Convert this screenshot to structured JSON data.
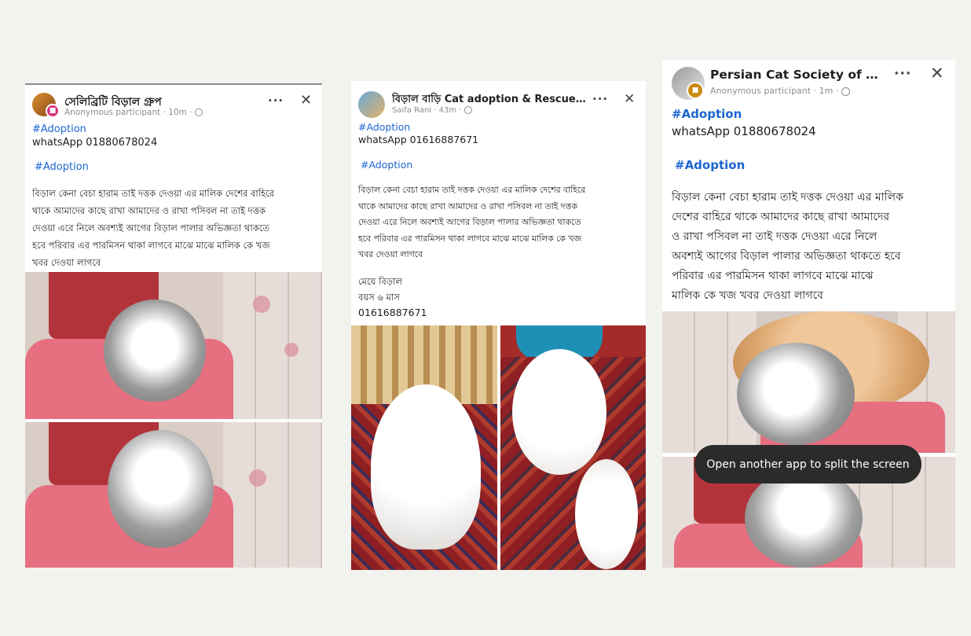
{
  "posts": [
    {
      "group_name": "সেলিব্রিটি বিড়াল গ্রুপ",
      "author": "Anonymous participant",
      "time": "10m",
      "hashtag1": "#Adoption",
      "phone_line": "whatsApp 01880678024",
      "hashtag2": "#Adoption",
      "body_lines": [
        "বিড়াল কেনা বেচা হারাম তাই দত্তক দেওয়া এর মালিক দেশের বাহিরে",
        "থাকে আমাদের কাছে রাখা আমাদের ও রাখা পসিবল না তাই দত্তক",
        "দেওয়া এরে নিলে অবশ্যই আগের বিড়াল পালার অভিজ্ঞতা থাকতে",
        "হবে পরিবার এর পারমিসন থাকা লাগবে মাঝে মাঝে মালিক কে খজ",
        "খবর দেওয়া লাগবে"
      ]
    },
    {
      "group_name": "বিড়াল বাড়ি Cat adoption & Rescue Society",
      "author": "Saifa Rani",
      "time": "43m",
      "hashtag1": "#Adoption",
      "phone_line": "whatsApp 01616887671",
      "hashtag2": "#Adoption",
      "body_lines": [
        "বিড়াল কেনা বেচা হারাম তাই দত্তক দেওয়া এর মালিক দেশের বাহিরে",
        "থাকে আমাদের কাছে রাখা আমাদের ও রাখা পসিবল না তাই দত্তক",
        "দেওয়া এরে নিলে অবশ্যই আগের বিড়াল পালার অভিজ্ঞতা থাকতে",
        "হবে পরিবার এর পারমিসন থাকা লাগবে মাঝে মাঝে মালিক কে খজ",
        "খবর দেওয়া লাগবে"
      ],
      "extra_lines": [
        "মেয়ে বিড়াল",
        "বয়স ৬ মাস",
        "01616887671"
      ]
    },
    {
      "group_name": "Persian Cat Society of Dhaka",
      "author": "Anonymous participant",
      "time": "1m",
      "hashtag1": "#Adoption",
      "phone_line": "whatsApp 01880678024",
      "hashtag2": "#Adoption",
      "body_lines": [
        "বিড়াল কেনা বেচা হারাম তাই দত্তক দেওয়া এর মালিক",
        "দেশের বাহিরে থাকে আমাদের কাছে রাখা আমাদের",
        "ও রাখা পসিবল না তাই দত্তক দেওয়া এরে নিলে",
        "অবশ্যই আগের বিড়াল পালার অভিজ্ঞতা থাকতে হবে",
        "পরিবার এর পারমিসন থাকা লাগবে মাঝে মাঝে",
        "মালিক কে খজ খবর দেওয়া লাগবে"
      ]
    }
  ],
  "ui": {
    "more": "···",
    "close": "✕",
    "dot": "·",
    "globe": "🌐",
    "toast": "Open another app to split the screen"
  },
  "colors": {
    "hashtag": "#1b66d1",
    "meta": "#8a8d91",
    "toast_bg": "#2b2b2b",
    "chair_pink": "#e66f80"
  }
}
